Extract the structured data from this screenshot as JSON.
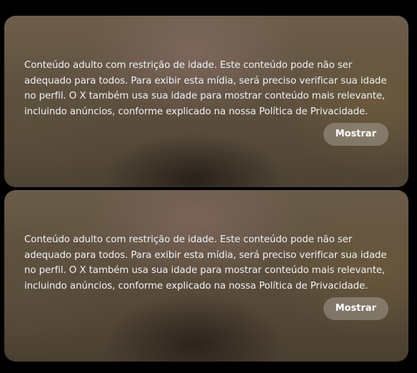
{
  "cards": [
    {
      "warning": "Conteúdo adulto com restrição de idade. Este conteúdo pode não ser adequado para todos. Para exibir esta mídia, será preciso verificar sua idade no perfil. O X também usa sua idade para mostrar conteúdo mais relevante, incluindo anúncios, conforme explicado na nossa Política de Privacidade.",
      "button_label": "Mostrar"
    },
    {
      "warning": "Conteúdo adulto com restrição de idade. Este conteúdo pode não ser adequado para todos. Para exibir esta mídia, será preciso verificar sua idade no perfil. O X também usa sua idade para mostrar conteúdo mais relevante, incluindo anúncios, conforme explicado na nossa Política de Privacidade.",
      "button_label": "Mostrar"
    }
  ],
  "colors": {
    "page_background": "#000000",
    "text": "#f2f2f2",
    "button_text": "#ffffff"
  }
}
